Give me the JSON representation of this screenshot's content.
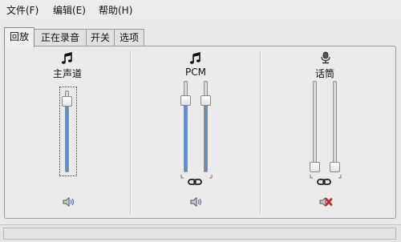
{
  "menu": {
    "file": "文件(F)",
    "edit": "编辑(E)",
    "help": "帮助(H)"
  },
  "tabs": [
    {
      "label": "回放",
      "active": true
    },
    {
      "label": "正在录音",
      "active": false
    },
    {
      "label": "开关",
      "active": false
    },
    {
      "label": "选项",
      "active": false
    }
  ],
  "channels": [
    {
      "label": "主声道",
      "icon": "music-note-icon",
      "levels": [
        0.92
      ],
      "locked": false,
      "muted": false,
      "mute_icon": "speaker-icon"
    },
    {
      "label": "PCM",
      "icon": "music-note-icon",
      "levels": [
        0.82,
        0.82
      ],
      "locked": true,
      "muted": false,
      "mute_icon": "speaker-icon"
    },
    {
      "label": "话筒",
      "icon": "microphone-icon",
      "levels": [
        0.0,
        0.0
      ],
      "locked": true,
      "muted": true,
      "mute_icon": "speaker-muted-icon"
    }
  ],
  "colors": {
    "fill": "#5b8fd0",
    "mute_x": "#d02020"
  },
  "statusbar": {
    "text": ""
  }
}
